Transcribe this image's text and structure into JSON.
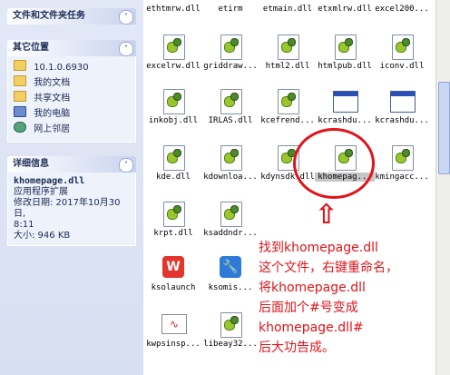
{
  "left_pane": {
    "file_tasks": {
      "title": "文件和文件夹任务",
      "chevron": "˅"
    },
    "other_places": {
      "title": "其它位置",
      "chevron": "˄",
      "items": [
        {
          "label": "10.1.0.6930",
          "icon": "folder-icon"
        },
        {
          "label": "我的文档",
          "icon": "folder-icon"
        },
        {
          "label": "共享文档",
          "icon": "folder-icon"
        },
        {
          "label": "我的电脑",
          "icon": "computer-icon"
        },
        {
          "label": "网上邻居",
          "icon": "network-icon"
        }
      ]
    },
    "details": {
      "title": "详细信息",
      "chevron": "˄",
      "file_name": "khomepage.dll",
      "file_type": "应用程序扩展",
      "modified_label": "修改日期: 2017年10月30日,",
      "modified_time": "8:11",
      "size": "大小: 946 KB"
    }
  },
  "files": {
    "row0": [
      "ethtmrw.dll",
      "etirm",
      "etmain.dll",
      "etxmlrw.dll",
      "excel200..."
    ],
    "row1": [
      "excelrw.dll",
      "griddraw...",
      "html2.dll",
      "htmlpub.dll",
      "iconv.dll"
    ],
    "row2": [
      "inkobj.dll",
      "IRLAS.dll",
      "kcefrend...",
      "kcrashdu...",
      "kcrashdu..."
    ],
    "row3": [
      "kde.dll",
      "kdownloa...",
      "kdynsdk.dll",
      "khomepag...",
      "kmingacc..."
    ],
    "row4": [
      "krpt.dll",
      "ksaddndr..."
    ],
    "row5": [
      "ksolaunch",
      "ksomis..."
    ],
    "row6": [
      "kwpsinsp...",
      "libeay32..."
    ],
    "wps_label": "W",
    "tool_label": "🔧",
    "wave_label": "∿"
  },
  "annotation": {
    "arrow": "⇧",
    "lines": [
      "找到khomepage.dll",
      "这个文件，右键重命名，",
      "将khomepage.dll",
      "后面加个#号变成",
      "khomepage.dll#",
      "后大功告成。"
    ],
    "color": "#e0141a"
  }
}
